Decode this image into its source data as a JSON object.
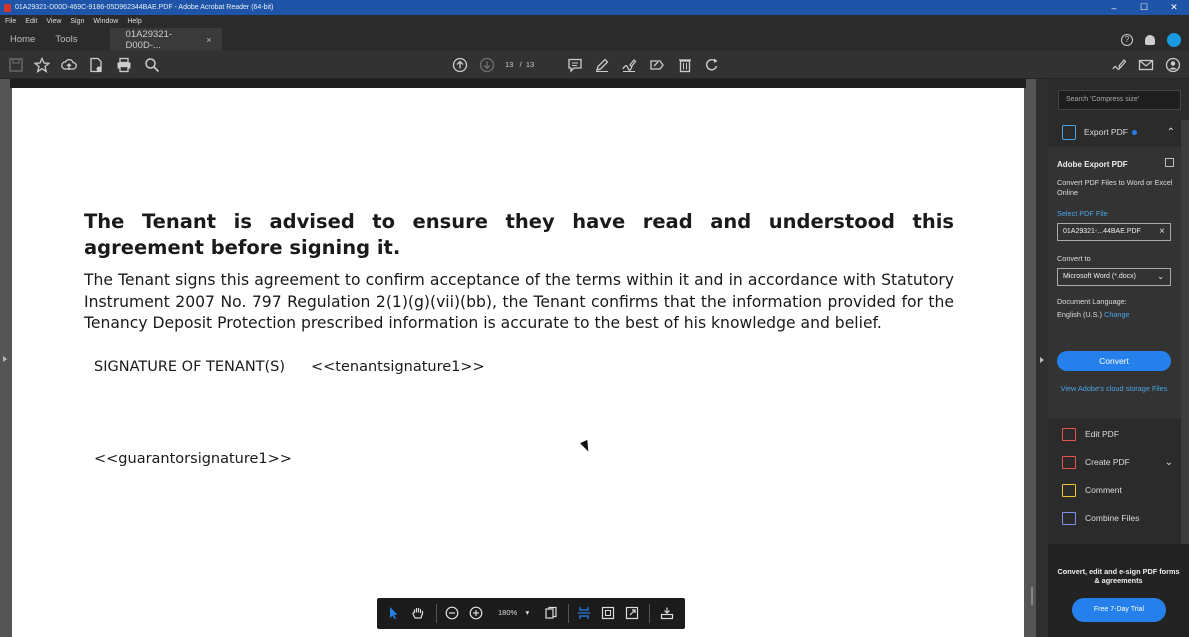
{
  "window": {
    "title": "01A29321-D00D-469C-9186-05D962344BAE.PDF - Adobe Acrobat Reader (64-bit)",
    "minimize": "–",
    "maximize": "☐",
    "close": "✕"
  },
  "menu": [
    "File",
    "Edit",
    "View",
    "Sign",
    "Window",
    "Help"
  ],
  "tabs": {
    "home": "Home",
    "tools": "Tools",
    "document": "01A29321-D00D-...",
    "close": "×",
    "help": "?"
  },
  "toolbar": {
    "current_page": "13",
    "page_separator": "/",
    "total_pages": "13"
  },
  "document": {
    "heading": "The Tenant is advised to ensure they have read and understood this agreement before signing it.",
    "paragraph": "The Tenant signs this agreement to confirm acceptance of the terms within it and in accordance with Statutory Instrument 2007 No. 797 Regulation 2(1)(g)(vii)(bb), the Tenant confirms that the information provided for the Tenancy Deposit Protection prescribed information is accurate to the best of his knowledge and belief.",
    "signature_label": "SIGNATURE OF TENANT(S)",
    "tenant_signature_tag": "<<tenantsignature1>>",
    "guarantor_signature_tag": "<<guarantorsignature1>>"
  },
  "floating_toolbar": {
    "zoom": "180%"
  },
  "right_pane": {
    "search_placeholder": "Search 'Compress size'",
    "export_header": "Export PDF",
    "export_title": "Adobe Export PDF",
    "export_description": "Convert PDF Files to Word or Excel Online",
    "select_file_label": "Select PDF File",
    "selected_file": "01A29321-...44BAE.PDF",
    "convert_to_label": "Convert to",
    "convert_to_value": "Microsoft Word (*.docx)",
    "language_label": "Document Language:",
    "language_value": "English (U.S.)",
    "language_change": "Change",
    "convert_button": "Convert",
    "cloud_link": "View Adobe's cloud storage Files",
    "tools": [
      {
        "label": "Edit PDF",
        "color": "#e8534a"
      },
      {
        "label": "Create PDF",
        "color": "#e8534a"
      },
      {
        "label": "Comment",
        "color": "#f2c230"
      },
      {
        "label": "Combine Files",
        "color": "#7a8ff0"
      }
    ],
    "promo_text": "Convert, edit and e-sign PDF forms & agreements",
    "trial_button": "Free 7-Day Trial"
  }
}
